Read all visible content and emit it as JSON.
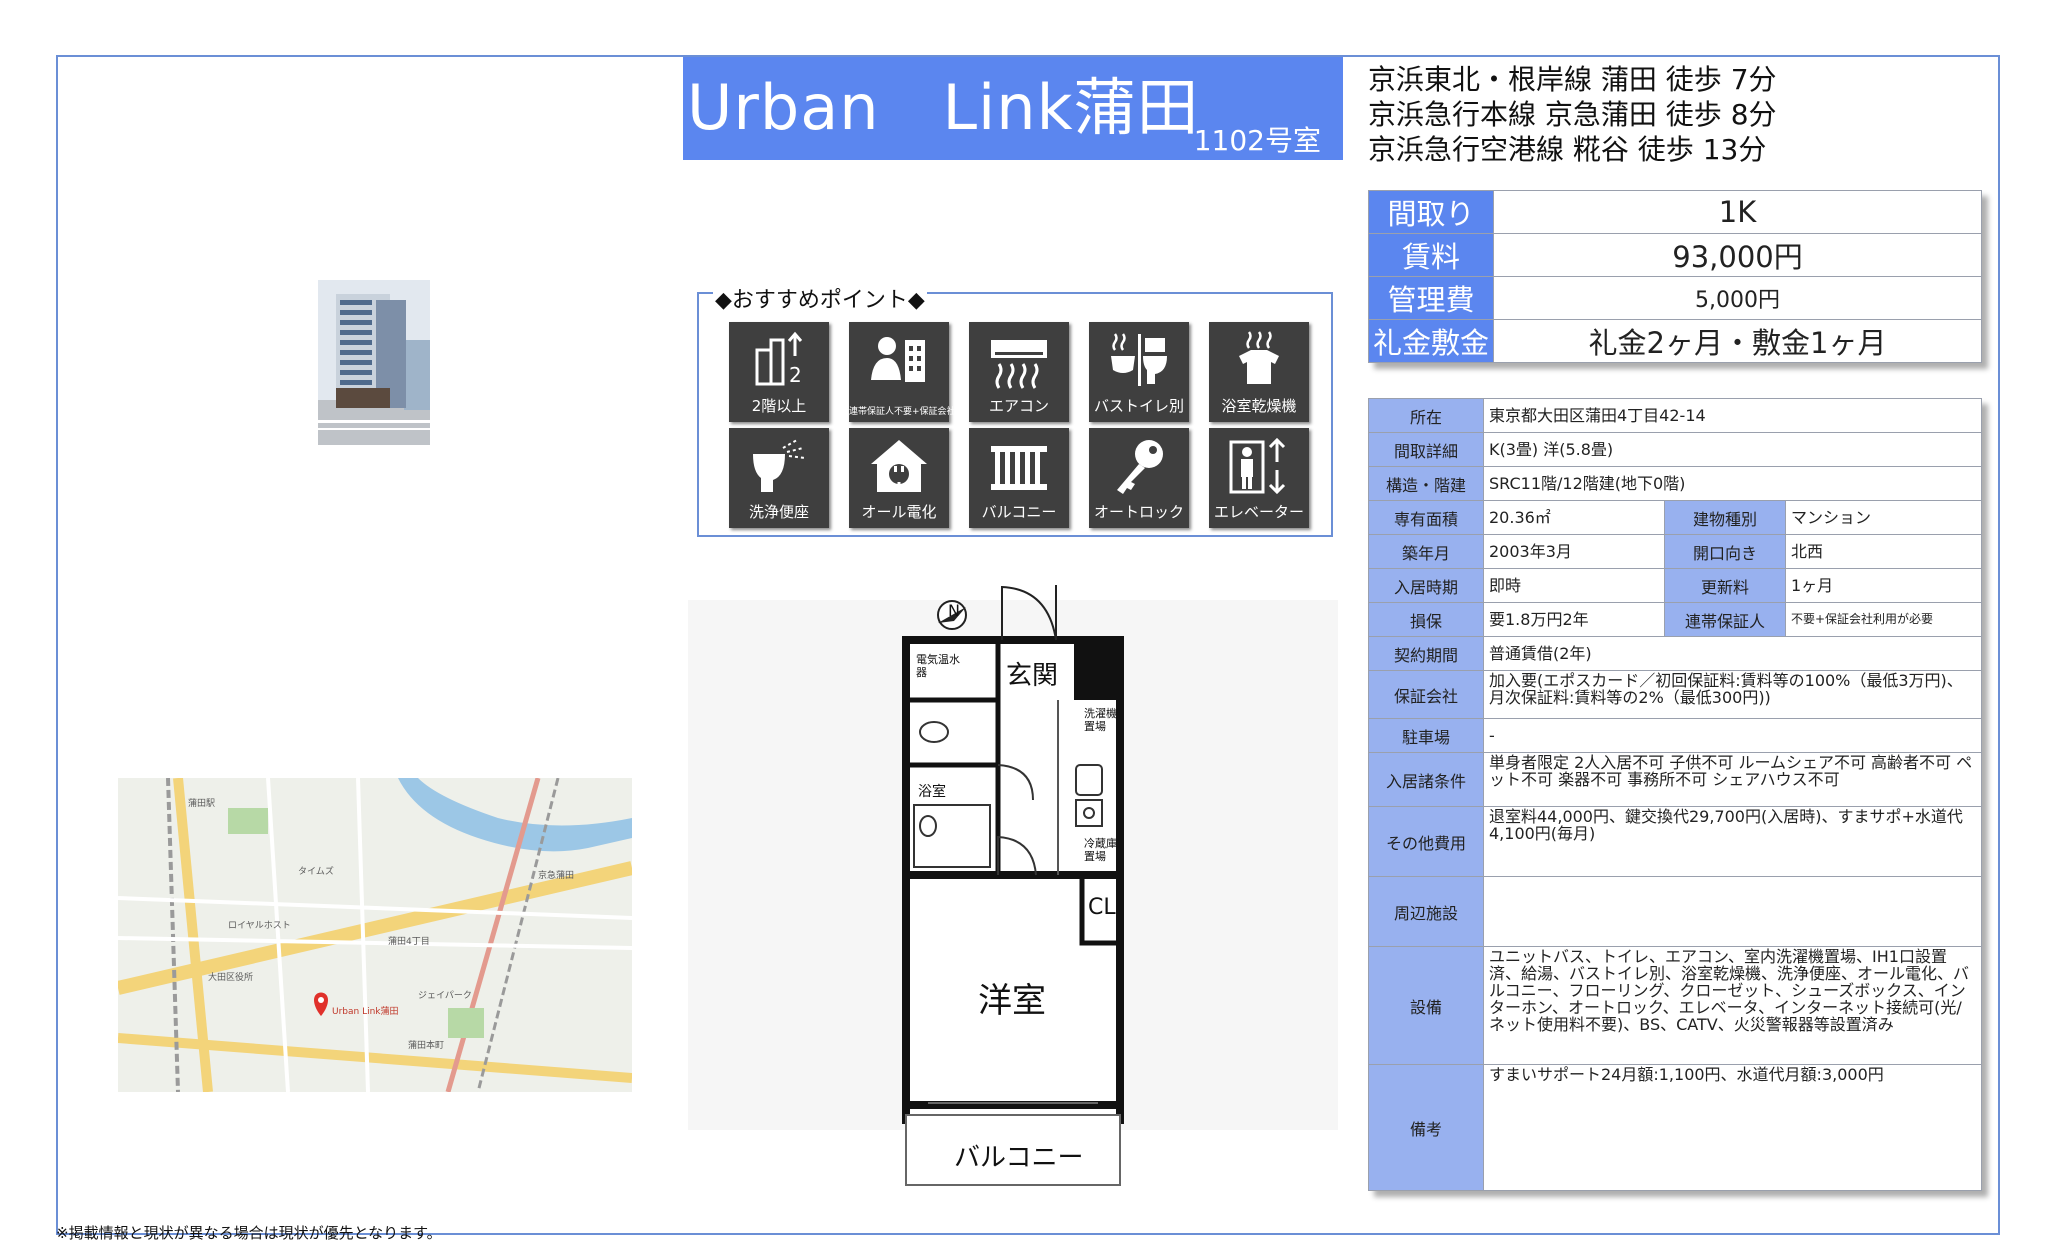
{
  "title": {
    "name": "Urban　Link蒲田",
    "room": "1102号室"
  },
  "stations": [
    "京浜東北・根岸線 蒲田 徒歩 7分",
    "京浜急行本線 京急蒲田 徒歩 8分",
    "京浜急行空港線 糀谷 徒歩 13分"
  ],
  "summary": {
    "layout_label": "間取り",
    "layout_value": "1K",
    "rent_label": "賃料",
    "rent_value": "93,000円",
    "mgmt_label": "管理費",
    "mgmt_value": "5,000円",
    "deposit_label": "礼金敷金",
    "deposit_value": "礼金2ヶ月・敷金1ヶ月"
  },
  "details": {
    "address_label": "所在",
    "address_value": "東京都大田区蒲田4丁目42-14",
    "layout_detail_label": "間取詳細",
    "layout_detail_value": "K(3畳) 洋(5.8畳)",
    "structure_label": "構造・階建",
    "structure_value": "SRC11階/12階建(地下0階)",
    "area_label": "専有面積",
    "area_value": "20.36㎡",
    "type_label": "建物種別",
    "type_value": "マンション",
    "built_label": "築年月",
    "built_value": "2003年3月",
    "facing_label": "開口向き",
    "facing_value": "北西",
    "movein_label": "入居時期",
    "movein_value": "即時",
    "renewal_label": "更新料",
    "renewal_value": "1ヶ月",
    "guarantee_label": "損保",
    "guarantee_value": "要1.8万円2年",
    "cosigner_label": "連帯保証人",
    "cosigner_value": "不要+保証会社利用が必要",
    "contract_label": "契約期間",
    "contract_value": "普通賃借(2年)",
    "company_label": "保証会社",
    "company_value": "加入要(エポスカード／初回保証料:賃料等の100%（最低3万円)、月次保証料:賃料等の2%（最低300円))",
    "parking_label": "駐車場",
    "parking_value": "-",
    "conditions_label": "入居諸条件",
    "conditions_value": "単身者限定 2人入居不可 子供不可 ルームシェア不可 高齢者不可 ペット不可 楽器不可 事務所不可 シェアハウス不可",
    "other_label": "その他費用",
    "other_value": "退室料44,000円、鍵交換代29,700円(入居時)、すまサポ+水道代4,100円(毎月)",
    "nearby_label": "周辺施設",
    "nearby_value": "",
    "equipment_label": "設備",
    "equipment_value": "ユニットバス、トイレ、エアコン、室内洗濯機置場、IH1口設置済、給湯、バストイレ別、浴室乾燥機、洗浄便座、オール電化、バルコニー、フローリング、クローゼット、シューズボックス、インターホン、オートロック、エレベータ、インターネット接続可(光/ネット使用料不要)、BS、CATV、火災警報器等設置済み",
    "remarks_label": "備考",
    "remarks_value": "すまいサポート24月額:1,100円、水道代月額:3,000円"
  },
  "recommend": {
    "heading": "◆おすすめポイント◆",
    "items": [
      {
        "label": "2階以上",
        "icon": "upper-floor-icon"
      },
      {
        "label": "連帯保証人不要+保証会社利用が必要",
        "icon": "guarantor-icon"
      },
      {
        "label": "エアコン",
        "icon": "air-conditioner-icon"
      },
      {
        "label": "バストイレ別",
        "icon": "separate-bath-toilet-icon"
      },
      {
        "label": "浴室乾燥機",
        "icon": "bathroom-dryer-icon"
      },
      {
        "label": "洗浄便座",
        "icon": "bidet-toilet-icon"
      },
      {
        "label": "オール電化",
        "icon": "all-electric-icon"
      },
      {
        "label": "バルコニー",
        "icon": "balcony-icon"
      },
      {
        "label": "オートロック",
        "icon": "auto-lock-key-icon"
      },
      {
        "label": "エレベーター",
        "icon": "elevator-icon"
      }
    ]
  },
  "floorplan": {
    "entrance": "玄関",
    "water_heater": "電気温水器",
    "washer": "洗濯機置場",
    "bath": "浴室",
    "fridge": "冷蔵庫置場",
    "closet": "CL",
    "western_room": "洋室",
    "balcony": "バルコニー",
    "north": "N"
  },
  "map": {
    "pin_label": "Urban Link蒲田",
    "labels": [
      "蒲田駅",
      "京急蒲田",
      "タイムズ",
      "ロイヤルホスト",
      "大田区役所",
      "蒲田4丁目",
      "蒲田本町",
      "ジェイパーク"
    ]
  },
  "footnote": "※掲載情報と現状が異なる場合は現状が優先となります。"
}
